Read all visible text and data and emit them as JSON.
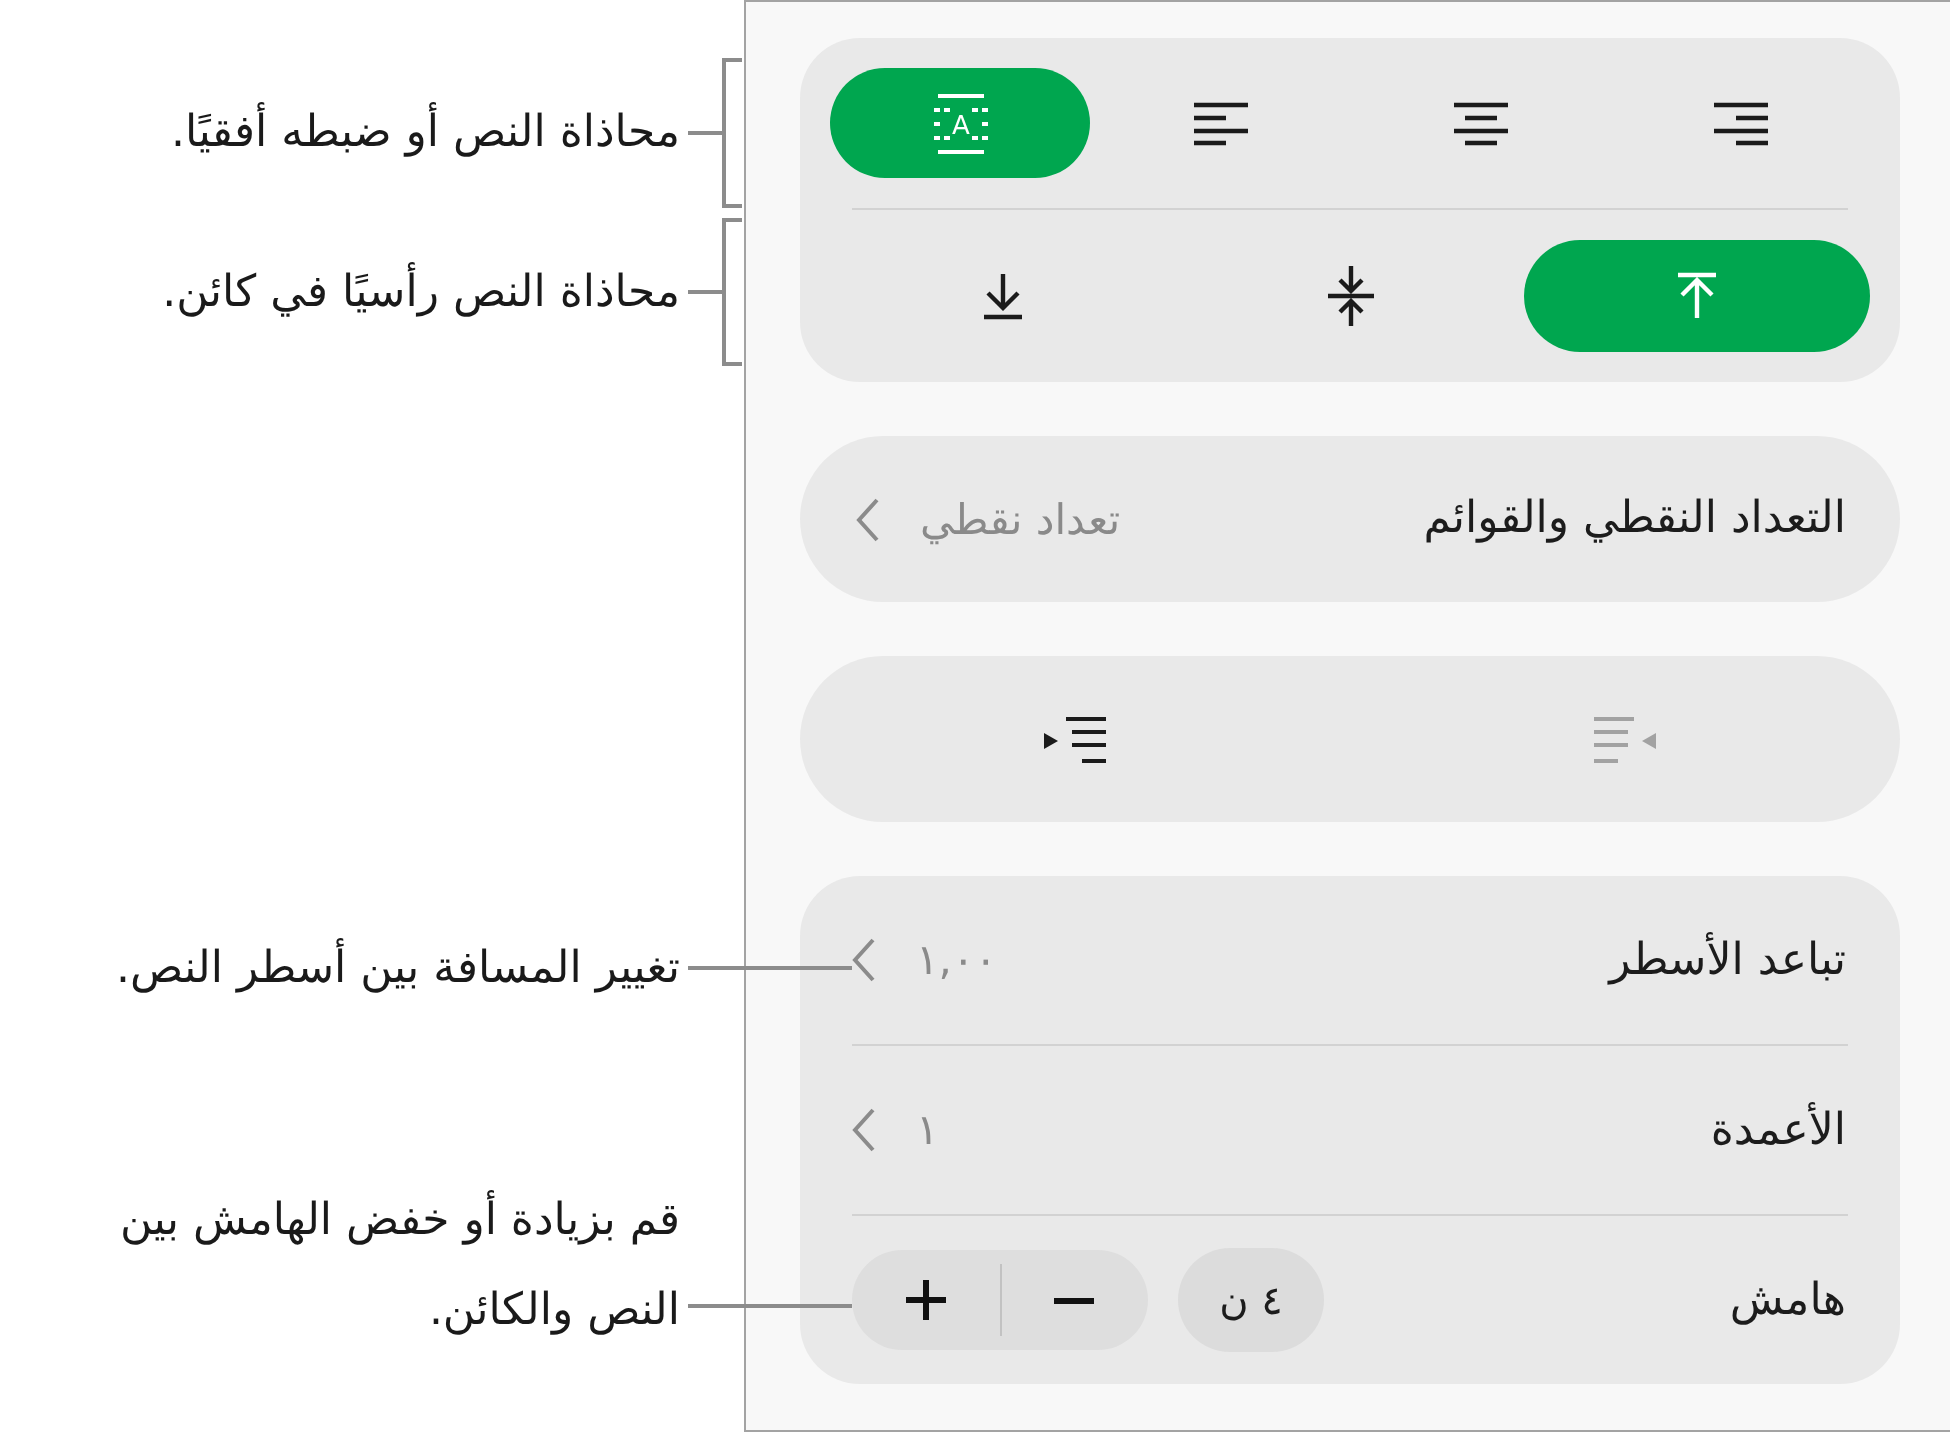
{
  "callouts": [
    {
      "kind": "bracket",
      "text": "محاذاة النص أو ضبطه أفقيًا."
    },
    {
      "kind": "bracket",
      "text": "محاذاة النص رأسيًا في كائن."
    },
    {
      "kind": "leader",
      "text": "تغيير المسافة بين أسطر النص."
    },
    {
      "kind": "leader",
      "text": "قم بزيادة أو خفض الهامش بين النص والكائن."
    }
  ],
  "panel": {
    "horizontal_alignment": [
      {
        "kind": "right",
        "selected": false
      },
      {
        "kind": "center",
        "selected": false
      },
      {
        "kind": "left",
        "selected": false
      },
      {
        "kind": "fit",
        "glyph": "A",
        "selected": true
      }
    ],
    "vertical_alignment": [
      {
        "kind": "top",
        "selected": true
      },
      {
        "kind": "middle",
        "selected": false
      },
      {
        "kind": "bottom",
        "selected": false
      }
    ],
    "bullets": {
      "label": "التعداد النقطي والقوائم",
      "value": "تعداد نقطي"
    },
    "indentation": [
      {
        "kind": "decrease",
        "disabled": true
      },
      {
        "kind": "increase",
        "disabled": false
      }
    ],
    "spacing": [
      {
        "kind": "menu",
        "label": "تباعد الأسطر",
        "value": "١,٠٠"
      },
      {
        "kind": "menu",
        "label": "الأعمدة",
        "value": "١"
      },
      {
        "kind": "stepper",
        "label": "هامش",
        "value": "٤ ن"
      }
    ]
  }
}
